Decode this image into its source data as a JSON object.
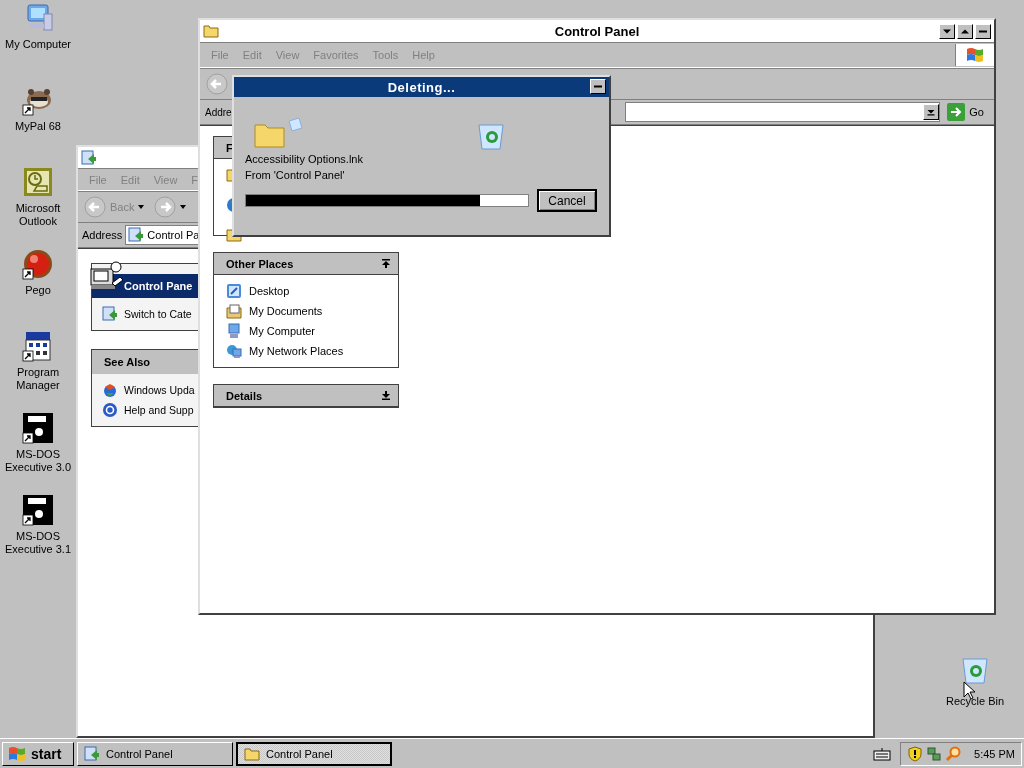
{
  "desktop_icons": [
    {
      "label": "My Computer",
      "kind": "computer",
      "shortcut": false
    },
    {
      "label": "MyPal 68",
      "kind": "raccoon",
      "shortcut": true
    },
    {
      "label": "Microsoft Outlook",
      "kind": "outlook",
      "shortcut": false
    },
    {
      "label": "Pego",
      "kind": "ball",
      "shortcut": true
    },
    {
      "label": "Program Manager",
      "kind": "programs",
      "shortcut": true
    },
    {
      "label": "MS-DOS Executive 3.0",
      "kind": "dos",
      "shortcut": true
    },
    {
      "label": "MS-DOS Executive 3.1",
      "kind": "dos",
      "shortcut": true
    }
  ],
  "back_window": {
    "menu": [
      "File",
      "Edit",
      "View",
      "F"
    ],
    "back_label": "Back",
    "address_label": "Address",
    "address_value": "Control Pa",
    "panes": [
      {
        "title": "Control Pane",
        "kind": "special",
        "items": [
          "Switch to Cate"
        ]
      },
      {
        "title": "See Also",
        "kind": "normal",
        "items": [
          "Windows Upda",
          "Help and Supp"
        ]
      }
    ]
  },
  "window": {
    "title": "Control Panel",
    "menu": [
      "File",
      "Edit",
      "View",
      "Favorites",
      "Tools",
      "Help"
    ],
    "address_label": "Addre",
    "go_label": "Go",
    "panes": [
      {
        "title": "F"
      },
      {
        "title": "Other Places",
        "expanded": true,
        "items": [
          "Desktop",
          "My Documents",
          "My Computer",
          "My Network Places"
        ]
      },
      {
        "title": "Details",
        "expanded": false
      }
    ]
  },
  "dialog": {
    "title": "Deleting...",
    "file": "Accessibility Options.lnk",
    "source": "From 'Control Panel'",
    "level": 0.83,
    "button": "Cancel"
  },
  "recycle_bin": {
    "label": "Recycle Bin"
  },
  "taskbar": {
    "start": "start",
    "tasks": [
      {
        "label": "Control Panel",
        "selected": false
      },
      {
        "label": "Control Panel",
        "selected": true
      }
    ],
    "clock": "5:45 PM"
  }
}
